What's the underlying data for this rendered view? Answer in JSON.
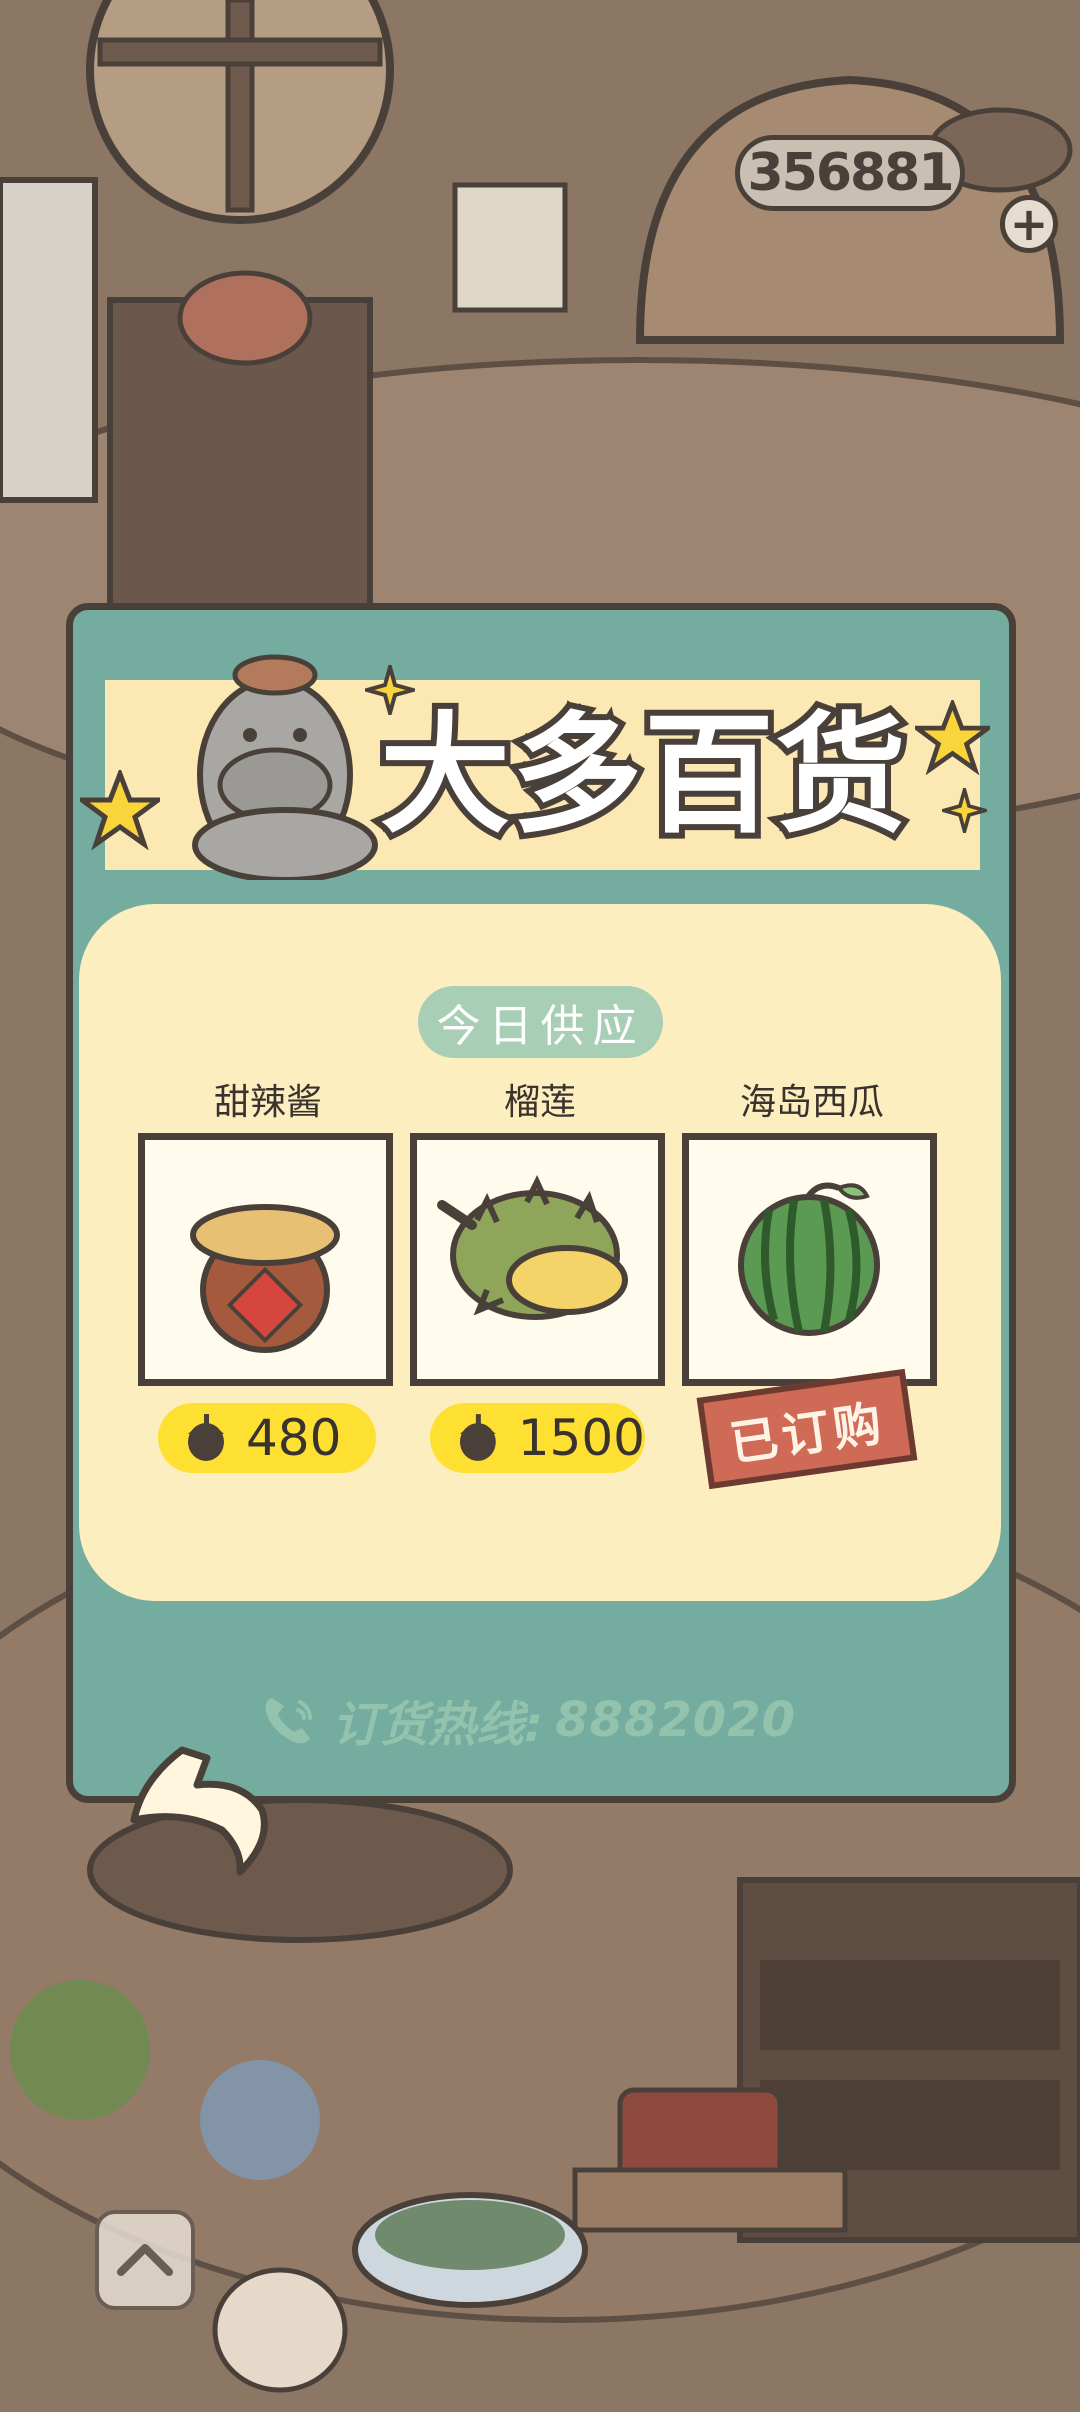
{
  "currency": {
    "amount": "356881",
    "add_symbol": "+"
  },
  "shop": {
    "title": "大多百货",
    "section_label": "今日供应",
    "items": [
      {
        "name": "甜辣酱",
        "price": "480",
        "icon": "chili-sauce-jar-icon"
      },
      {
        "name": "榴莲",
        "price": "1500",
        "icon": "durian-icon"
      },
      {
        "name": "海岛西瓜",
        "status": "已订购",
        "icon": "watermelon-icon"
      }
    ],
    "hotline_label": "订货热线:",
    "hotline_number": "8882020"
  },
  "colors": {
    "panel": "#74ac9f",
    "banner": "#fbe8b2",
    "list_bg": "#fdeec0",
    "price_pill": "#fee032",
    "ordered_stamp": "#cf6a56",
    "outline": "#4a403a"
  }
}
